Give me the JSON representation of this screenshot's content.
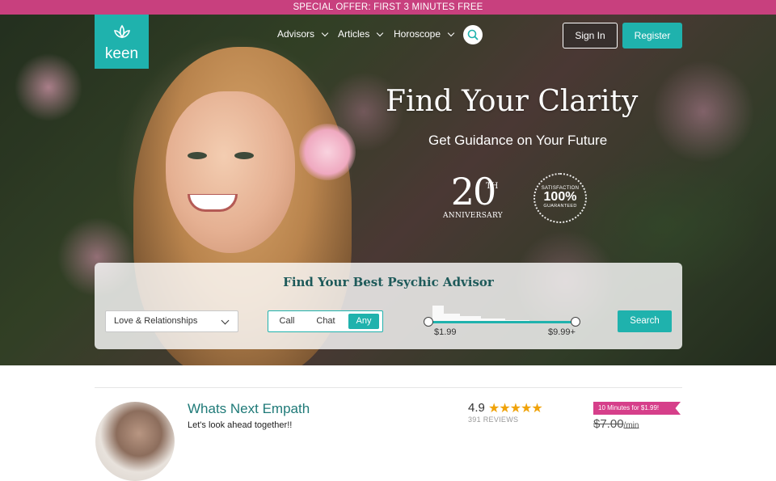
{
  "promo": {
    "text": "SPECIAL OFFER: FIRST 3 MINUTES FREE"
  },
  "header": {
    "logo_text": "keen",
    "nav": [
      {
        "label": "Advisors"
      },
      {
        "label": "Articles"
      },
      {
        "label": "Horoscope"
      }
    ],
    "sign_in": "Sign In",
    "register": "Register"
  },
  "hero": {
    "title": "Find Your Clarity",
    "subtitle": "Get Guidance on Your Future",
    "anniversary": {
      "number": "20",
      "suffix": "TH",
      "label": "ANNIVERSARY"
    },
    "guarantee": {
      "top": "SATISFACTION",
      "big": "100%",
      "bottom": "GUARANTEED"
    }
  },
  "finder": {
    "title": "Find Your Best Psychic Advisor",
    "category_selected": "Love & Relationships",
    "modes": [
      {
        "label": "Call",
        "active": false
      },
      {
        "label": "Chat",
        "active": false
      },
      {
        "label": "Any",
        "active": true
      }
    ],
    "price_min": "$1.99",
    "price_max": "$9.99+",
    "search_label": "Search"
  },
  "advisor": {
    "name": "Whats Next Empath",
    "tagline": "Let's look ahead together!!",
    "rating": "4.9",
    "stars": "★★★★★",
    "reviews": "391 REVIEWS",
    "offer": "10 Minutes for $1.99!",
    "old_price": "$7.00",
    "old_price_unit": "/min"
  },
  "colors": {
    "accent": "#1fb2ad",
    "promo": "#c8407e",
    "offer": "#d63f8a",
    "star": "#f0a30a"
  }
}
